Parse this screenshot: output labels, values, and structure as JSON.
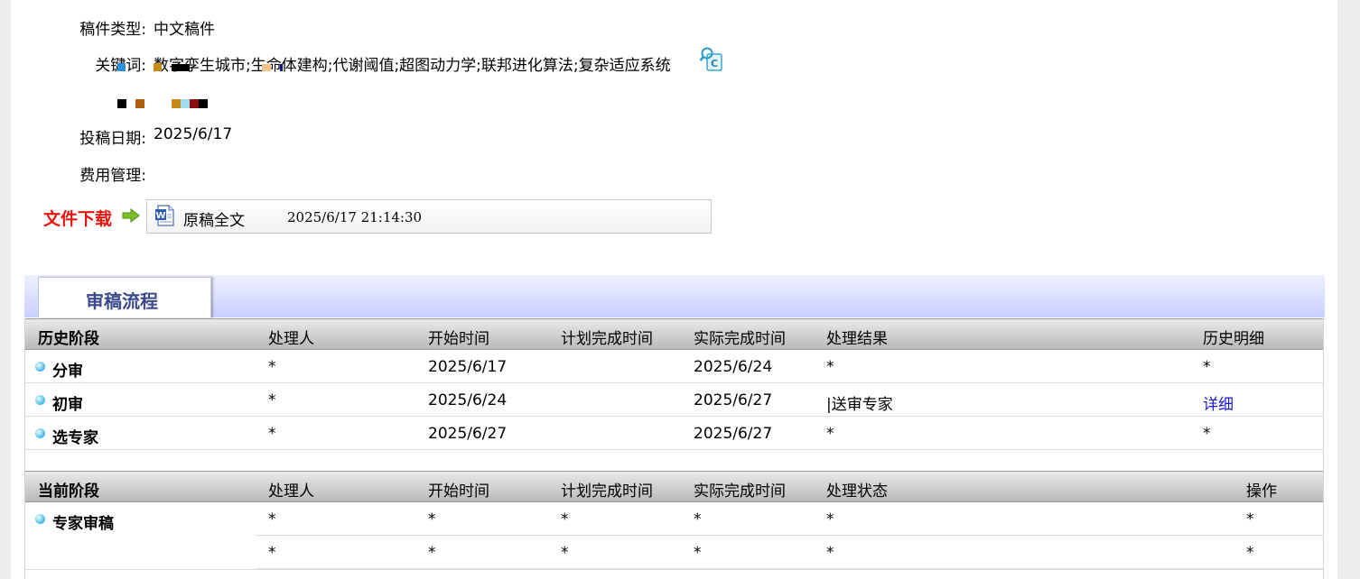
{
  "info": {
    "type_label": "稿件类型:",
    "type_value": "中文稿件",
    "keywords_label": "关键词:",
    "keywords_value": "数字孪生城市;生命体建构;代谢阈值;超图动力学;联邦进化算法;复杂适应系统",
    "date_label": "投稿日期:",
    "date_value": "2025/6/17",
    "fee_label": "费用管理:",
    "fee_value": ""
  },
  "download": {
    "label": "文件下载",
    "file_name": "原稿全文",
    "file_date": "2025/6/17 21:14:30"
  },
  "tab": {
    "label": "审稿流程"
  },
  "history": {
    "headers": [
      "历史阶段",
      "处理人",
      "开始时间",
      "计划完成时间",
      "实际完成时间",
      "处理结果",
      "历史明细"
    ],
    "rows": [
      {
        "stage": "分审",
        "handler": "*",
        "start": "2025/6/17",
        "planned": "",
        "actual": "2025/6/24",
        "result": "*",
        "detail": "*"
      },
      {
        "stage": "初审",
        "handler": "*",
        "start": "2025/6/24",
        "planned": "",
        "actual": "2025/6/27",
        "result": "|送审专家",
        "detail": "详细"
      },
      {
        "stage": "选专家",
        "handler": "*",
        "start": "2025/6/27",
        "planned": "",
        "actual": "2025/6/27",
        "result": "*",
        "detail": "*"
      }
    ]
  },
  "current": {
    "headers": [
      "当前阶段",
      "处理人",
      "开始时间",
      "计划完成时间",
      "实际完成时间",
      "处理状态",
      "操作"
    ],
    "stage": "专家审稿",
    "rows": [
      {
        "handler": "*",
        "start": "*",
        "planned": "*",
        "actual": "*",
        "status": "*",
        "action": "*"
      },
      {
        "handler": "*",
        "start": "*",
        "planned": "*",
        "actual": "*",
        "status": "*",
        "action": "*"
      }
    ]
  },
  "colors": {
    "download_label": "#e8140f",
    "tab_text": "#3b4a8c",
    "link": "#1b1bd6",
    "tab_bar": "#c9d0ff"
  },
  "icons": [
    "search-doc-icon",
    "green-arrow-icon",
    "word-doc-icon",
    "bullet-dot-icon"
  ]
}
